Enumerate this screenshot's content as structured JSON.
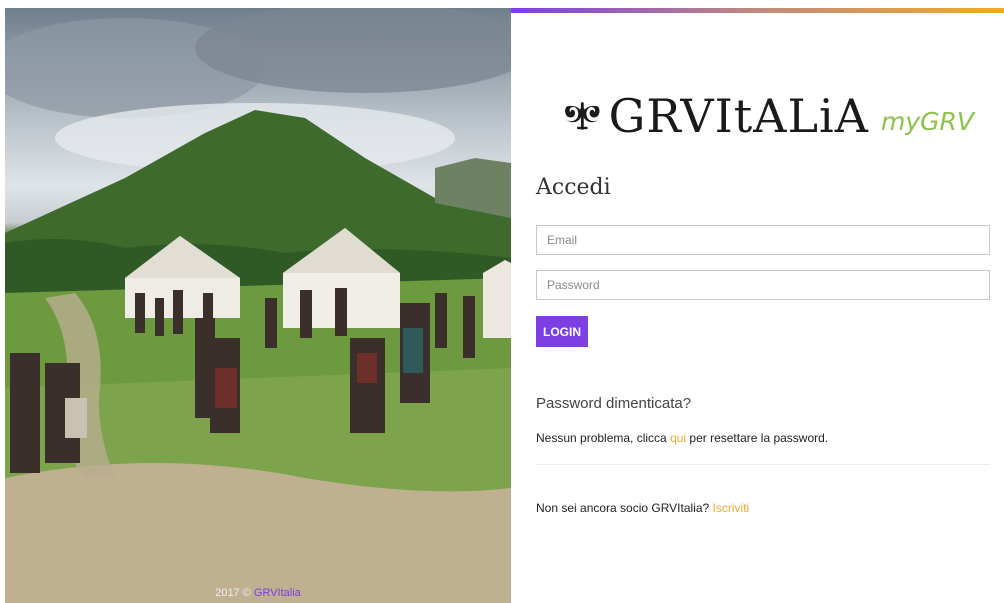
{
  "photo": {
    "copyright_prefix": "2017 © ",
    "copyright_brand": "GRVItalia"
  },
  "logo": {
    "text": "GRVItALiA",
    "sub": "myGRV"
  },
  "login": {
    "heading": "Accedi",
    "email_placeholder": "Email",
    "password_placeholder": "Password",
    "button_label": "LOGIN"
  },
  "forgot": {
    "title": "Password dimenticata?",
    "text_before": "Nessun problema, clicca ",
    "link": "qui",
    "text_after": " per resettare la password."
  },
  "signup": {
    "text": "Non sei ancora socio GRVItalia? ",
    "link": "Iscriviti"
  },
  "colors": {
    "accent_purple": "#7b3fe4",
    "accent_orange": "#f0a92c",
    "logo_green": "#8bc24a"
  }
}
